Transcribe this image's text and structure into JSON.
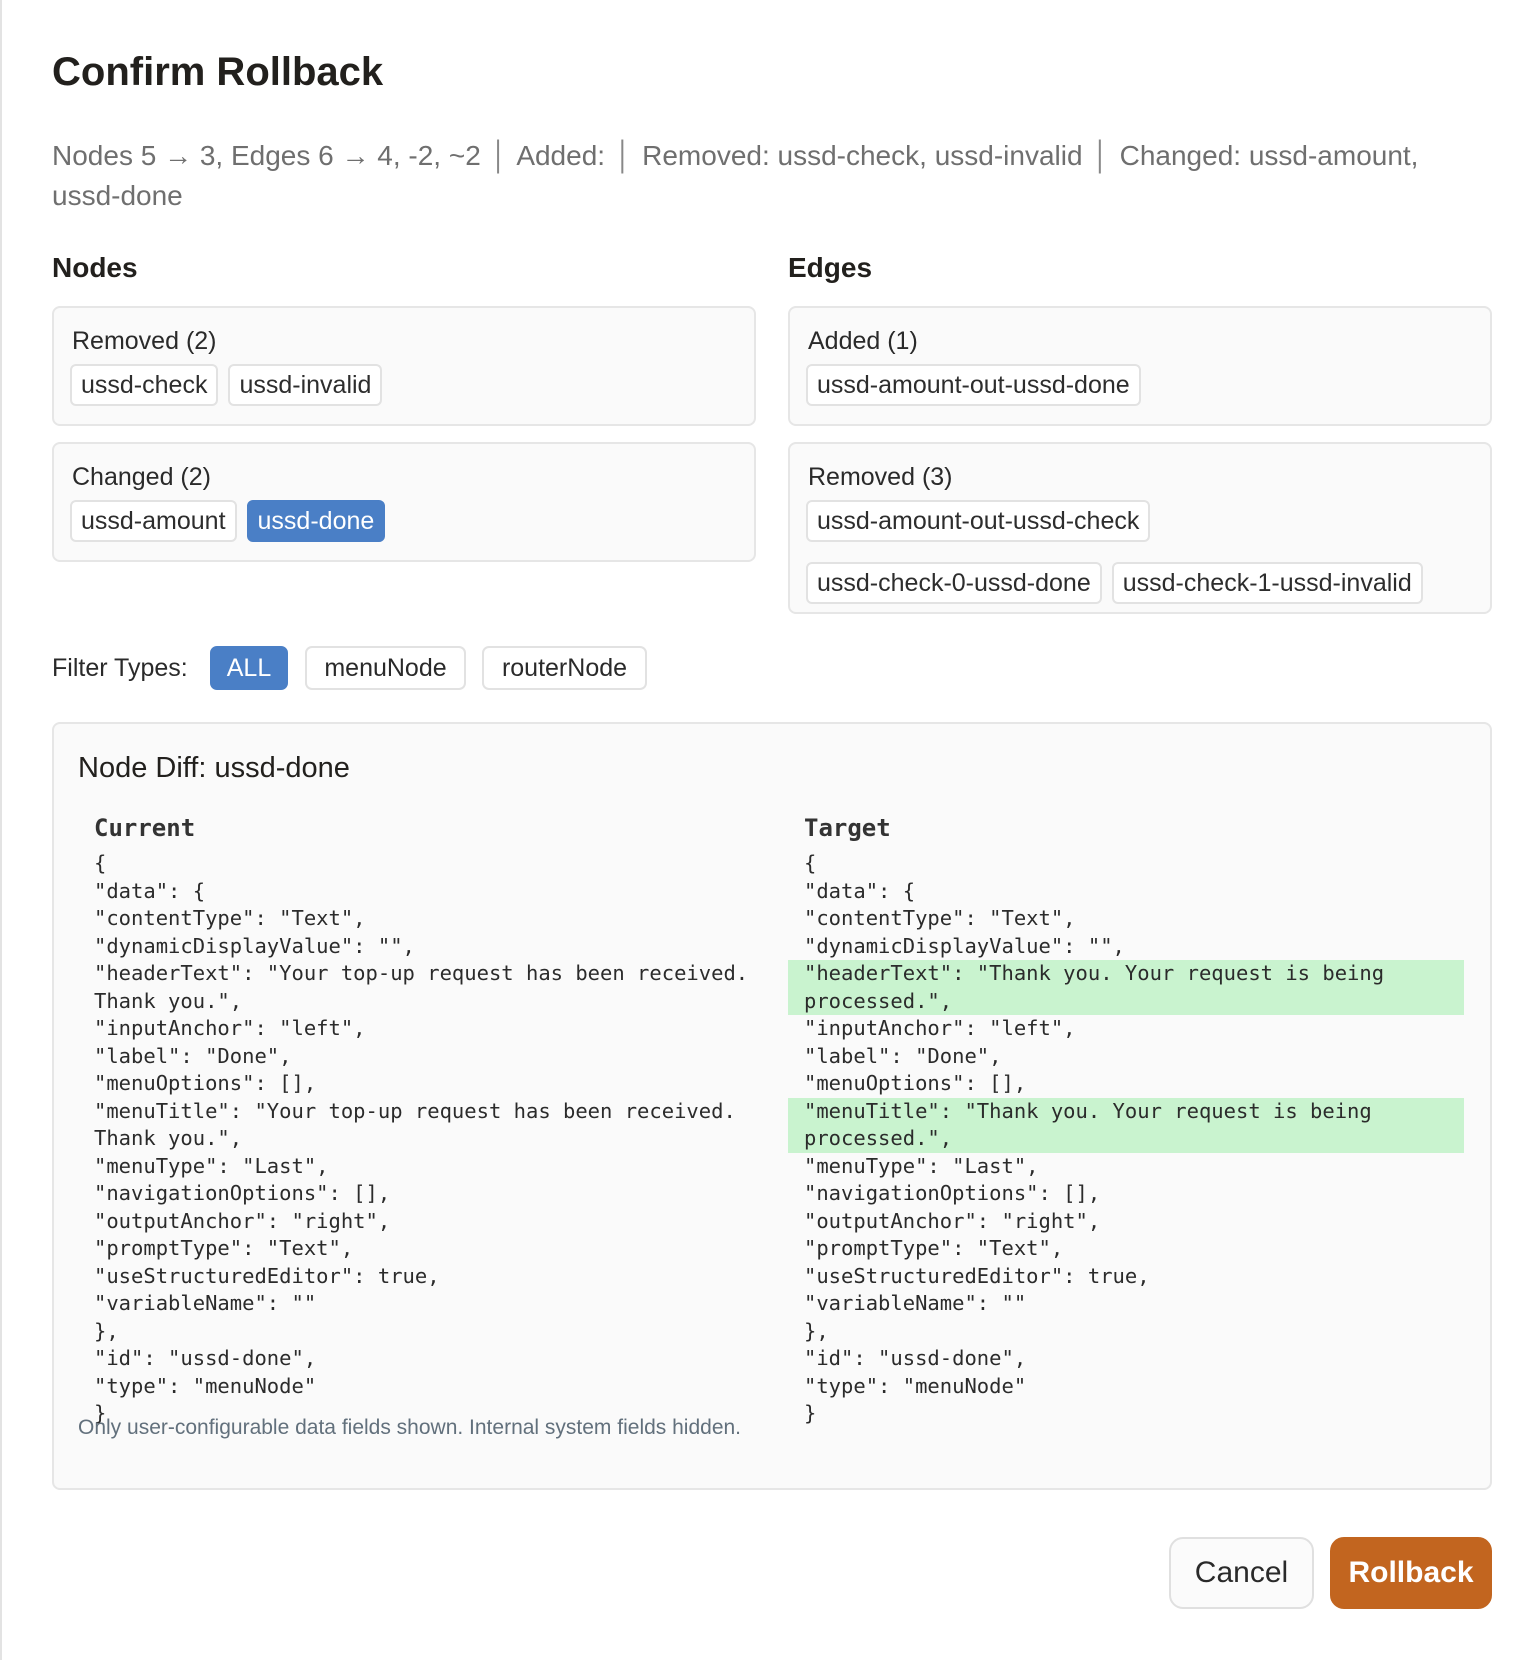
{
  "dialog": {
    "title": "Confirm Rollback",
    "summary": {
      "counts": "Nodes 5 → 3, Edges 6 → 4, -2, ~2",
      "added": "Added:",
      "removed": "Removed: ussd-check, ussd-invalid",
      "changed": "Changed: ussd-amount, ussd-done"
    }
  },
  "nodes": {
    "title": "Nodes",
    "removed": {
      "label": "Removed (2)",
      "items": [
        "ussd-check",
        "ussd-invalid"
      ]
    },
    "changed": {
      "label": "Changed (2)",
      "items": [
        "ussd-amount",
        "ussd-done"
      ],
      "selected": "ussd-done"
    }
  },
  "edges": {
    "title": "Edges",
    "added": {
      "label": "Added (1)",
      "items": [
        "ussd-amount-out-ussd-done"
      ]
    },
    "removed": {
      "label": "Removed (3)",
      "items": [
        "ussd-amount-out-ussd-check",
        "ussd-check-0-ussd-done",
        "ussd-check-1-ussd-invalid"
      ]
    }
  },
  "filter": {
    "label": "Filter Types:",
    "options": [
      "ALL",
      "menuNode",
      "routerNode"
    ],
    "active": "ALL"
  },
  "diff": {
    "title": "Node Diff: ussd-done",
    "current_label": "Current",
    "target_label": "Target",
    "current_lines": [
      "{",
      "\"data\": {",
      "\"contentType\": \"Text\",",
      "\"dynamicDisplayValue\": \"\",",
      "\"headerText\": \"Your top-up request has been received.",
      "Thank you.\",",
      "\"inputAnchor\": \"left\",",
      "\"label\": \"Done\",",
      "\"menuOptions\": [],",
      "\"menuTitle\": \"Your top-up request has been received.",
      "Thank you.\",",
      "\"menuType\": \"Last\",",
      "\"navigationOptions\": [],",
      "\"outputAnchor\": \"right\",",
      "\"promptType\": \"Text\",",
      "\"useStructuredEditor\": true,",
      "\"variableName\": \"\"",
      "},",
      "\"id\": \"ussd-done\",",
      "\"type\": \"menuNode\"",
      "}"
    ],
    "target_lines": [
      "{",
      "\"data\": {",
      "\"contentType\": \"Text\",",
      "\"dynamicDisplayValue\": \"\",",
      "\"headerText\": \"Thank you. Your request is being",
      "processed.\",",
      "\"inputAnchor\": \"left\",",
      "\"label\": \"Done\",",
      "\"menuOptions\": [],",
      "\"menuTitle\": \"Thank you. Your request is being",
      "processed.\",",
      "\"menuType\": \"Last\",",
      "\"navigationOptions\": [],",
      "\"outputAnchor\": \"right\",",
      "\"promptType\": \"Text\",",
      "\"useStructuredEditor\": true,",
      "\"variableName\": \"\"",
      "},",
      "\"id\": \"ussd-done\",",
      "\"type\": \"menuNode\"",
      "}"
    ],
    "target_highlight_lines": [
      4,
      5,
      9,
      10
    ],
    "highlight_color": "#c9f3cf",
    "note": "Only user-configurable data fields shown. Internal system fields hidden."
  },
  "actions": {
    "cancel": "Cancel",
    "rollback": "Rollback",
    "rollback_color": "#c2651f",
    "accent_color": "#4a7fc6"
  }
}
